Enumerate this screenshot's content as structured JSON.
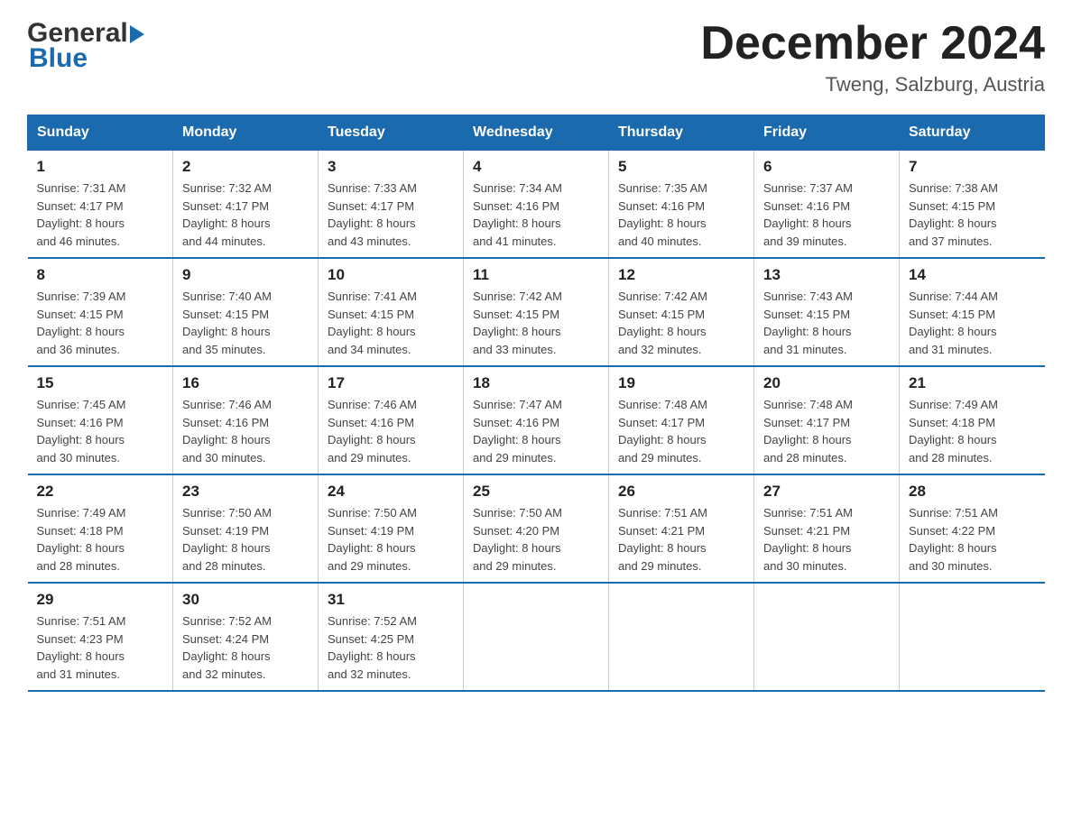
{
  "logo": {
    "general": "General",
    "blue": "Blue"
  },
  "header": {
    "month": "December 2024",
    "location": "Tweng, Salzburg, Austria"
  },
  "days_of_week": [
    "Sunday",
    "Monday",
    "Tuesday",
    "Wednesday",
    "Thursday",
    "Friday",
    "Saturday"
  ],
  "weeks": [
    [
      {
        "day": "1",
        "sunrise": "7:31 AM",
        "sunset": "4:17 PM",
        "daylight": "8 hours and 46 minutes."
      },
      {
        "day": "2",
        "sunrise": "7:32 AM",
        "sunset": "4:17 PM",
        "daylight": "8 hours and 44 minutes."
      },
      {
        "day": "3",
        "sunrise": "7:33 AM",
        "sunset": "4:17 PM",
        "daylight": "8 hours and 43 minutes."
      },
      {
        "day": "4",
        "sunrise": "7:34 AM",
        "sunset": "4:16 PM",
        "daylight": "8 hours and 41 minutes."
      },
      {
        "day": "5",
        "sunrise": "7:35 AM",
        "sunset": "4:16 PM",
        "daylight": "8 hours and 40 minutes."
      },
      {
        "day": "6",
        "sunrise": "7:37 AM",
        "sunset": "4:16 PM",
        "daylight": "8 hours and 39 minutes."
      },
      {
        "day": "7",
        "sunrise": "7:38 AM",
        "sunset": "4:15 PM",
        "daylight": "8 hours and 37 minutes."
      }
    ],
    [
      {
        "day": "8",
        "sunrise": "7:39 AM",
        "sunset": "4:15 PM",
        "daylight": "8 hours and 36 minutes."
      },
      {
        "day": "9",
        "sunrise": "7:40 AM",
        "sunset": "4:15 PM",
        "daylight": "8 hours and 35 minutes."
      },
      {
        "day": "10",
        "sunrise": "7:41 AM",
        "sunset": "4:15 PM",
        "daylight": "8 hours and 34 minutes."
      },
      {
        "day": "11",
        "sunrise": "7:42 AM",
        "sunset": "4:15 PM",
        "daylight": "8 hours and 33 minutes."
      },
      {
        "day": "12",
        "sunrise": "7:42 AM",
        "sunset": "4:15 PM",
        "daylight": "8 hours and 32 minutes."
      },
      {
        "day": "13",
        "sunrise": "7:43 AM",
        "sunset": "4:15 PM",
        "daylight": "8 hours and 31 minutes."
      },
      {
        "day": "14",
        "sunrise": "7:44 AM",
        "sunset": "4:15 PM",
        "daylight": "8 hours and 31 minutes."
      }
    ],
    [
      {
        "day": "15",
        "sunrise": "7:45 AM",
        "sunset": "4:16 PM",
        "daylight": "8 hours and 30 minutes."
      },
      {
        "day": "16",
        "sunrise": "7:46 AM",
        "sunset": "4:16 PM",
        "daylight": "8 hours and 30 minutes."
      },
      {
        "day": "17",
        "sunrise": "7:46 AM",
        "sunset": "4:16 PM",
        "daylight": "8 hours and 29 minutes."
      },
      {
        "day": "18",
        "sunrise": "7:47 AM",
        "sunset": "4:16 PM",
        "daylight": "8 hours and 29 minutes."
      },
      {
        "day": "19",
        "sunrise": "7:48 AM",
        "sunset": "4:17 PM",
        "daylight": "8 hours and 29 minutes."
      },
      {
        "day": "20",
        "sunrise": "7:48 AM",
        "sunset": "4:17 PM",
        "daylight": "8 hours and 28 minutes."
      },
      {
        "day": "21",
        "sunrise": "7:49 AM",
        "sunset": "4:18 PM",
        "daylight": "8 hours and 28 minutes."
      }
    ],
    [
      {
        "day": "22",
        "sunrise": "7:49 AM",
        "sunset": "4:18 PM",
        "daylight": "8 hours and 28 minutes."
      },
      {
        "day": "23",
        "sunrise": "7:50 AM",
        "sunset": "4:19 PM",
        "daylight": "8 hours and 28 minutes."
      },
      {
        "day": "24",
        "sunrise": "7:50 AM",
        "sunset": "4:19 PM",
        "daylight": "8 hours and 29 minutes."
      },
      {
        "day": "25",
        "sunrise": "7:50 AM",
        "sunset": "4:20 PM",
        "daylight": "8 hours and 29 minutes."
      },
      {
        "day": "26",
        "sunrise": "7:51 AM",
        "sunset": "4:21 PM",
        "daylight": "8 hours and 29 minutes."
      },
      {
        "day": "27",
        "sunrise": "7:51 AM",
        "sunset": "4:21 PM",
        "daylight": "8 hours and 30 minutes."
      },
      {
        "day": "28",
        "sunrise": "7:51 AM",
        "sunset": "4:22 PM",
        "daylight": "8 hours and 30 minutes."
      }
    ],
    [
      {
        "day": "29",
        "sunrise": "7:51 AM",
        "sunset": "4:23 PM",
        "daylight": "8 hours and 31 minutes."
      },
      {
        "day": "30",
        "sunrise": "7:52 AM",
        "sunset": "4:24 PM",
        "daylight": "8 hours and 32 minutes."
      },
      {
        "day": "31",
        "sunrise": "7:52 AM",
        "sunset": "4:25 PM",
        "daylight": "8 hours and 32 minutes."
      },
      null,
      null,
      null,
      null
    ]
  ],
  "labels": {
    "sunrise": "Sunrise:",
    "sunset": "Sunset:",
    "daylight": "Daylight:"
  }
}
